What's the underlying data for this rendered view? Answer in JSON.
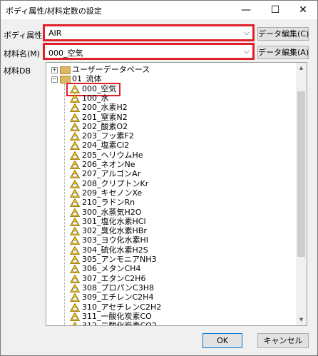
{
  "window": {
    "title": "ボディ属性/材料定数の設定",
    "minimize_glyph": "—",
    "maximize_glyph": "☐",
    "close_glyph": "✕"
  },
  "body_attr": {
    "label": "ボディ属性名",
    "value": "AIR",
    "button": "データ編集(C)"
  },
  "material": {
    "label": "材料名(M)",
    "value": "000_空気",
    "button": "データ編集(A)"
  },
  "db": {
    "label": "材料DB"
  },
  "tree": {
    "user_db": "ユーザーデータベース",
    "fluid_folder": "01_流体",
    "items": [
      "000_空気",
      "100_水",
      "200_水素H2",
      "201_窒素N2",
      "202_酸素O2",
      "203_フッ素F2",
      "204_塩素Cl2",
      "205_ヘリウムHe",
      "206_ネオンNe",
      "207_アルゴンAr",
      "208_クリプトンKr",
      "209_キセノンXe",
      "210_ラドンRn",
      "300_水蒸気H2O",
      "301_塩化水素HCl",
      "302_臭化水素HBr",
      "303_ヨウ化水素HI",
      "304_硫化水素H2S",
      "305_アンモニアNH3",
      "306_メタンCH4",
      "307_エタンC2H6",
      "308_プロパンC3H8",
      "309_エチレンC2H4",
      "310_アセチレンC2H2",
      "311_一酸化炭素CO",
      "312_二酸化炭素CO2"
    ],
    "selected": "000_空気"
  },
  "buttons": {
    "ok": "OK",
    "cancel": "キャンセル"
  },
  "colors": {
    "highlight": "#e0202a",
    "window_bg": "#f0f0f0",
    "focus": "#0078d7"
  },
  "icons": {
    "material": "warning-triangle-icon",
    "folder": "folder-icon"
  }
}
